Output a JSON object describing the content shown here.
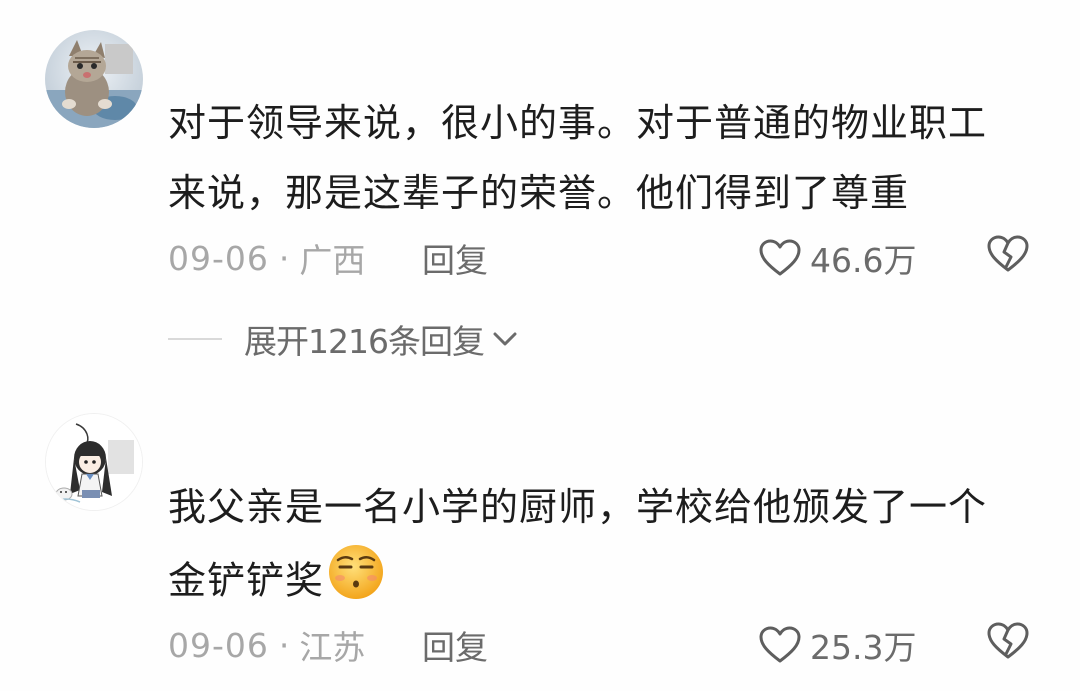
{
  "comments": [
    {
      "avatar": "cat-avatar",
      "text_line1": "对于领导来说，很小的事。对于普通的物业职工",
      "text_line2": "来说，那是这辈子的荣誉。他们得到了尊重",
      "date": "09-06",
      "separator": "·",
      "location": "广西",
      "reply_label": "回复",
      "likes": "46.6万",
      "expand_label": "展开1216条回复"
    },
    {
      "avatar": "anime-girl-avatar",
      "text_line1": "我父亲是一名小学的厨师，学校给他颁发了一个",
      "text_line2": "金铲铲奖",
      "emoji": "smirk-emoji",
      "date": "09-06",
      "separator": "·",
      "location": "江苏",
      "reply_label": "回复",
      "likes": "25.3万"
    }
  ],
  "icons": {
    "like": "heart-outline-icon",
    "dislike": "broken-heart-icon",
    "expand": "chevron-down-icon"
  },
  "colors": {
    "text": "#1d1d1d",
    "meta": "#a7a7a7",
    "action": "#6b6b6b"
  }
}
